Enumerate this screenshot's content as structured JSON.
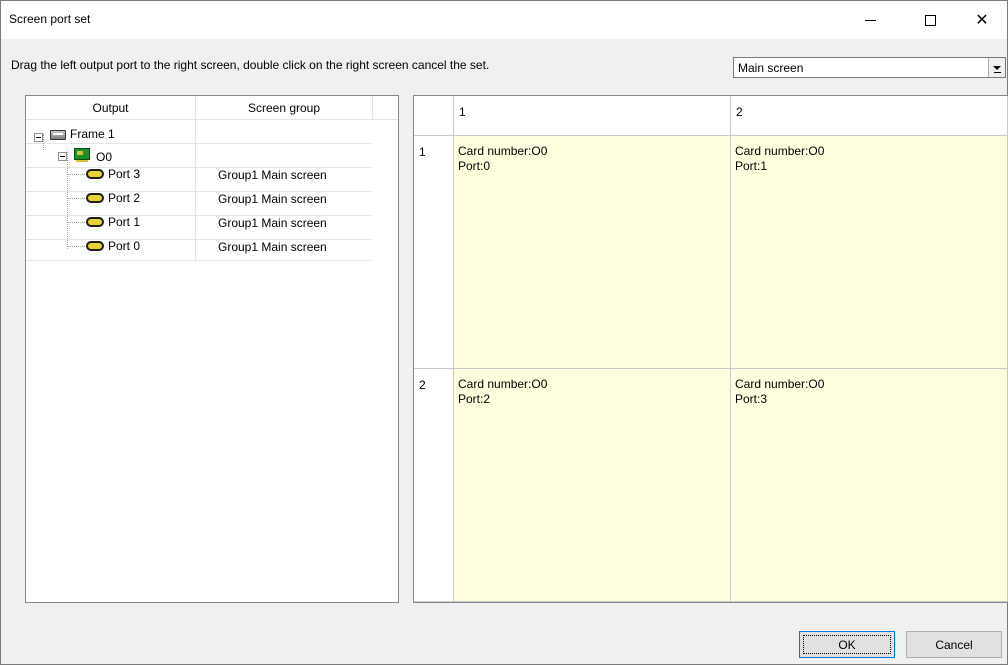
{
  "window": {
    "title": "Screen port set",
    "controls": {
      "minimize": "—",
      "maximize": "☐",
      "close": "✕"
    }
  },
  "instruction": "Drag the left output port to the right screen, double click on the right screen cancel the set.",
  "screen_select": {
    "value": "Main screen"
  },
  "tree": {
    "columns": [
      "Output",
      "Screen group"
    ],
    "rows": [
      {
        "label": "Frame 1",
        "group": ""
      },
      {
        "label": "O0",
        "group": ""
      },
      {
        "label": "Port 3",
        "group": "Group1 Main screen"
      },
      {
        "label": "Port 2",
        "group": "Group1 Main screen"
      },
      {
        "label": "Port 1",
        "group": "Group1 Main screen"
      },
      {
        "label": "Port 0",
        "group": "Group1 Main screen"
      }
    ]
  },
  "grid": {
    "col_headers": [
      "1",
      "2"
    ],
    "row_headers": [
      "1",
      "2"
    ],
    "cells": [
      [
        {
          "card": "Card number:O0",
          "port": "Port:0"
        },
        {
          "card": "Card number:O0",
          "port": "Port:1"
        }
      ],
      [
        {
          "card": "Card number:O0",
          "port": "Port:2"
        },
        {
          "card": "Card number:O0",
          "port": "Port:3"
        }
      ]
    ]
  },
  "buttons": {
    "ok": "OK",
    "cancel": "Cancel"
  }
}
